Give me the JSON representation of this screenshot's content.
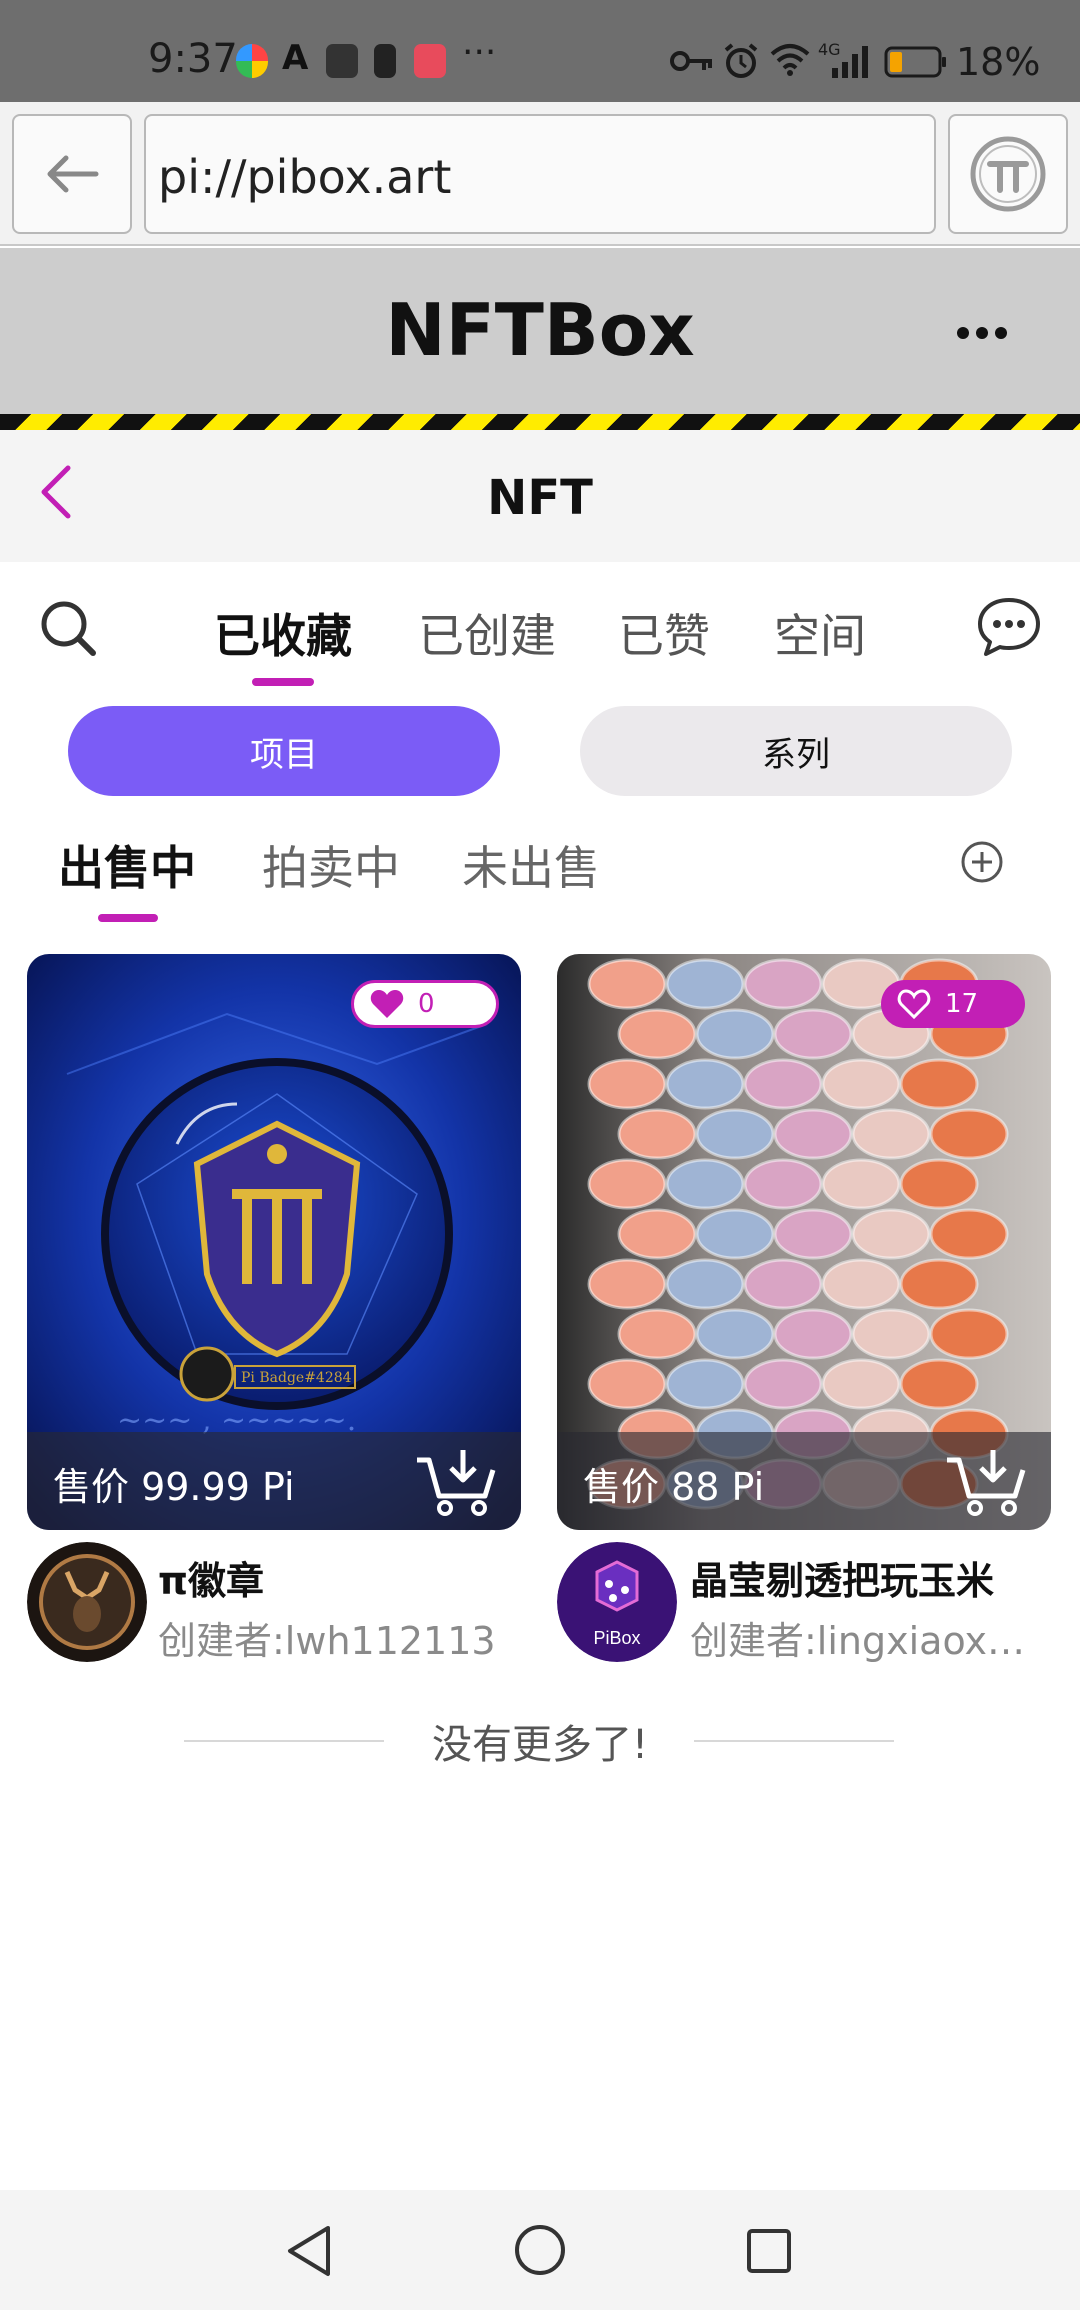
{
  "status_bar": {
    "time": "9:37",
    "dots": "···",
    "network": "4G",
    "battery_pct": "18%"
  },
  "browser": {
    "url": "pi://pibox.art",
    "back_icon": "arrow-left-icon",
    "pi_icon": "pi-logo-icon"
  },
  "app": {
    "title": "NFTBox",
    "more_icon": "ellipsis-icon"
  },
  "sub_header": {
    "title": "NFT",
    "back_icon": "chevron-left-icon"
  },
  "tabs": [
    {
      "label": "已收藏",
      "active": true
    },
    {
      "label": "已创建",
      "active": false
    },
    {
      "label": "已赞",
      "active": false
    },
    {
      "label": "空间",
      "active": false
    }
  ],
  "segments": {
    "items": "项目",
    "series": "系列"
  },
  "sale_tabs": [
    {
      "label": "出售中",
      "active": true
    },
    {
      "label": "拍卖中",
      "active": false
    },
    {
      "label": "未出售",
      "active": false
    }
  ],
  "cards": [
    {
      "likes": "0",
      "liked": true,
      "price": "售价 99.99 Pi",
      "name": "π徽章",
      "creator": "创建者:lwh112113",
      "image_text": "Pi Badge#4284"
    },
    {
      "likes": "17",
      "liked": false,
      "price": "售价 88 Pi",
      "name": "晶莹剔透把玩玉米",
      "creator": "创建者:lingxiaoxi...",
      "avatar_label": "PiBox"
    }
  ],
  "footer": {
    "end_text": "没有更多了!"
  },
  "colors": {
    "accent": "#c21fb5",
    "segment_active": "#7b5cf6"
  }
}
